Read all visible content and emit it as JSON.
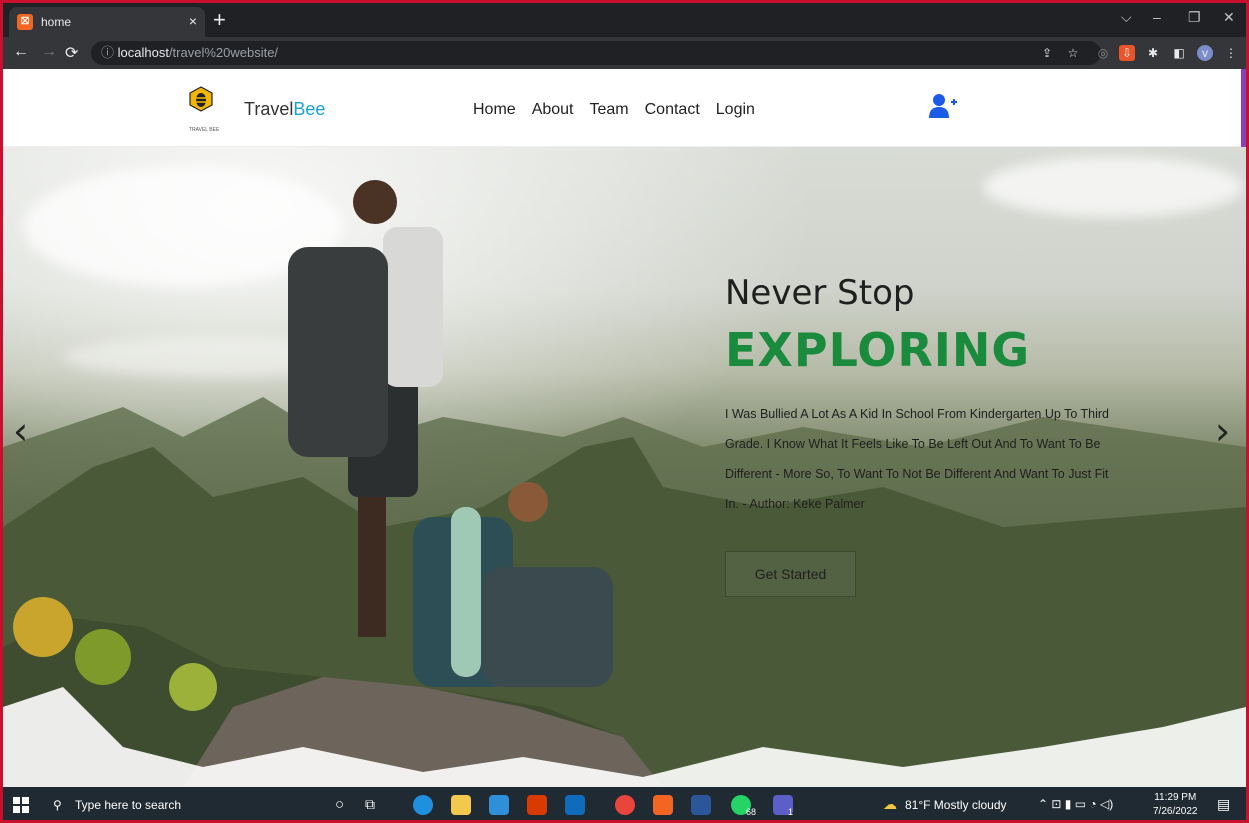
{
  "browser": {
    "tab_title": "home",
    "tab_close": "×",
    "new_tab": "+",
    "url_host": "localhost",
    "url_path": "/travel%20website/",
    "window_controls": [
      "⌵",
      "–",
      "❐",
      "✕"
    ]
  },
  "site": {
    "logo_subtext": "TRAVEL BEE",
    "brand_prefix": "Travel",
    "brand_accent": "Bee",
    "nav": [
      "Home",
      "About",
      "Team",
      "Contact",
      "Login"
    ],
    "accent_color": "#1a8a3c",
    "brand_color": "#1aa0d8"
  },
  "hero": {
    "headline": "Never Stop",
    "highlight": "EXPLORING",
    "quote": "I Was Bullied A Lot As A Kid In School From Kindergarten Up To Third Grade. I Know What It Feels Like To Be Left Out And To Want To Be Different - More So, To Want To Not Be Different And Want To Just Fit In. - Author: Keke Palmer",
    "cta_label": "Get Started",
    "prev_arrow": "‹",
    "next_arrow": "›"
  },
  "taskbar": {
    "search_placeholder": "Type here to search",
    "weather": "81°F  Mostly cloudy",
    "time": "11:29 PM",
    "date": "7/26/2022",
    "badge_whatsapp": "68",
    "badge_teams": "1"
  }
}
